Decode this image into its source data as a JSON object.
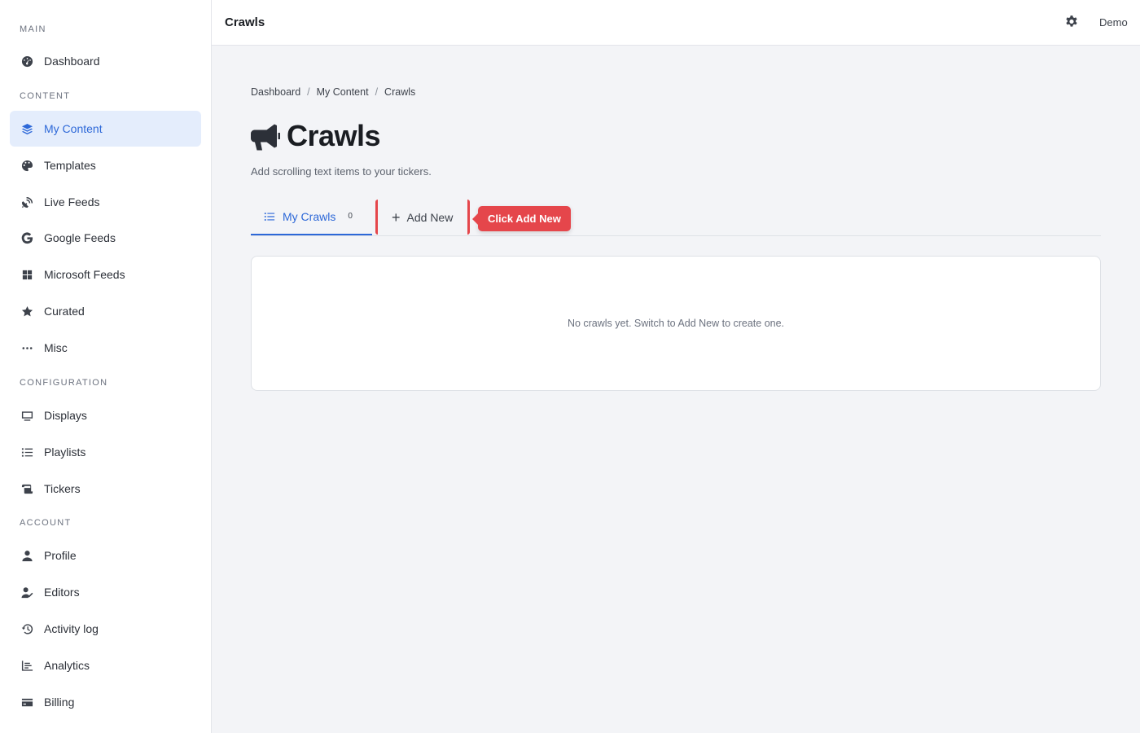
{
  "sidebar": {
    "sections": [
      {
        "title": "MAIN"
      },
      {
        "title": "CONTENT"
      },
      {
        "title": "CONFIGURATION"
      },
      {
        "title": "ACCOUNT"
      }
    ],
    "items": [
      {
        "label": "Dashboard",
        "icon": "gauge-icon"
      },
      {
        "label": "My Content",
        "icon": "layers-icon",
        "active": true
      },
      {
        "label": "Templates",
        "icon": "palette-icon"
      },
      {
        "label": "Live Feeds",
        "icon": "satellite-dish-icon"
      },
      {
        "label": "Google Feeds",
        "icon": "google-icon"
      },
      {
        "label": "Microsoft Feeds",
        "icon": "windows-icon"
      },
      {
        "label": "Curated",
        "icon": "star-icon"
      },
      {
        "label": "Misc",
        "icon": "ellipsis-icon"
      },
      {
        "label": "Displays",
        "icon": "monitor-icon"
      },
      {
        "label": "Playlists",
        "icon": "list-icon"
      },
      {
        "label": "Tickers",
        "icon": "scroll-icon"
      },
      {
        "label": "Profile",
        "icon": "user-icon"
      },
      {
        "label": "Editors",
        "icon": "user-pen-icon"
      },
      {
        "label": "Activity log",
        "icon": "history-icon"
      },
      {
        "label": "Analytics",
        "icon": "chart-icon"
      },
      {
        "label": "Billing",
        "icon": "credit-card-icon"
      }
    ]
  },
  "topbar": {
    "title": "Crawls",
    "settings_icon": "gear-icon",
    "user": "Demo"
  },
  "breadcrumb": [
    "Dashboard",
    "My Content",
    "Crawls"
  ],
  "page": {
    "title": "Crawls",
    "title_icon": "megaphone-icon",
    "subtitle": "Add scrolling text items to your tickers."
  },
  "tabs": {
    "my_crawls": {
      "label": "My Crawls",
      "count": "0"
    },
    "add_new": {
      "label": "Add New"
    }
  },
  "callout": "Click Add New",
  "empty_message": "No crawls yet. Switch to Add New to create one.",
  "colors": {
    "accent": "#2d68d8",
    "highlight": "#e5464b",
    "active_bg": "#e4edfc"
  }
}
